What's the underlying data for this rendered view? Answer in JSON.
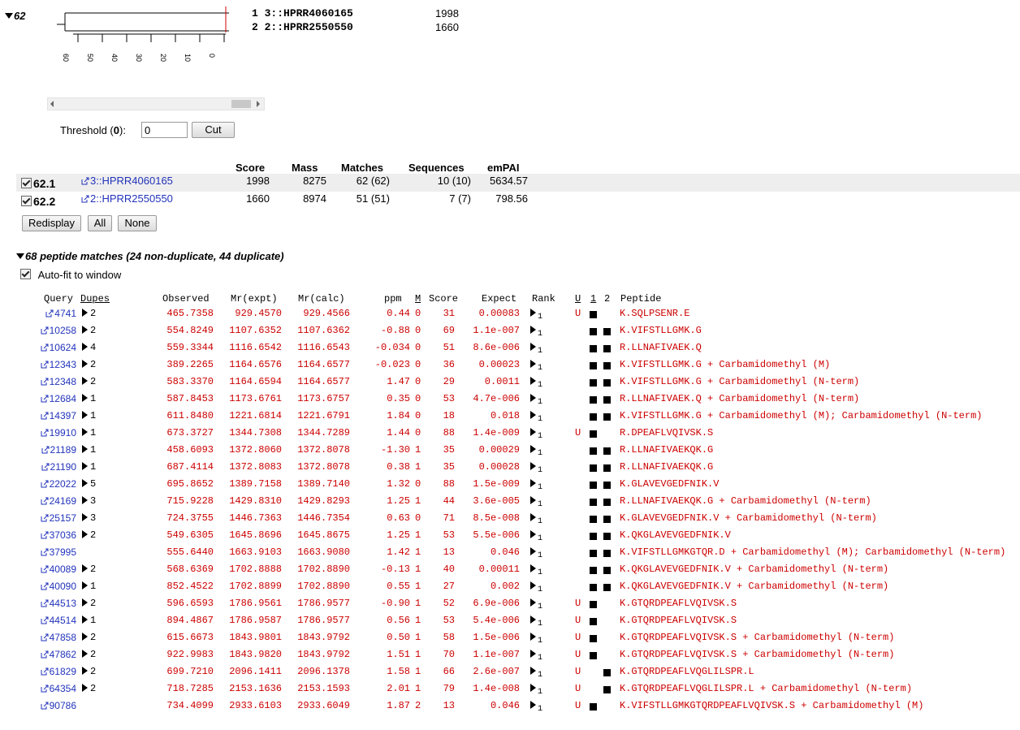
{
  "tree": {
    "node_label": "62",
    "axis_ticks": [
      "60",
      "50",
      "40",
      "30",
      "20",
      "10",
      "0"
    ],
    "hits": [
      {
        "num": "1",
        "name": "3::HPRR4060165",
        "score": "1998"
      },
      {
        "num": "2",
        "name": "2::HPRR2550550",
        "score": "1660"
      }
    ]
  },
  "threshold": {
    "label_pre": "Threshold (",
    "label_bold": "0",
    "label_post": "):",
    "value": "0",
    "cut_label": "Cut"
  },
  "proteins": {
    "headers": {
      "score": "Score",
      "mass": "Mass",
      "matches": "Matches",
      "sequences": "Sequences",
      "empai": "emPAI"
    },
    "rows": [
      {
        "id": "62.1",
        "name": "3::HPRR4060165",
        "score": "1998",
        "mass": "8275",
        "matches": "62 (62)",
        "sequences": "10 (10)",
        "empai": "5634.57"
      },
      {
        "id": "62.2",
        "name": "2::HPRR2550550",
        "score": "1660",
        "mass": "8974",
        "matches": "51 (51)",
        "sequences": "7 (7)",
        "empai": "798.56"
      }
    ],
    "buttons": {
      "redisplay": "Redisplay",
      "all": "All",
      "none": "None"
    }
  },
  "peptides": {
    "section_title": "68 peptide matches (24 non-duplicate, 44 duplicate)",
    "autofit_label": "Auto-fit to window",
    "headers": {
      "query": "Query",
      "dupes": "Dupes",
      "observed": "Observed",
      "mr_expt": "Mr(expt)",
      "mr_calc": "Mr(calc)",
      "ppm": "ppm",
      "m": "M",
      "score": "Score",
      "expect": "Expect",
      "rank": "Rank",
      "u": "U",
      "p1": "1",
      "p2": "2",
      "peptide": "Peptide"
    },
    "rows": [
      {
        "query": "4741",
        "dupes": "2",
        "observed": "465.7358",
        "mr_expt": "929.4570",
        "mr_calc": "929.4566",
        "ppm": "0.44",
        "m": "0",
        "score": "31",
        "expect": "0.00083",
        "rank": "1",
        "u": "U",
        "p1": true,
        "p2": false,
        "peptide": "K.SQLPSENR.E"
      },
      {
        "query": "10258",
        "dupes": "2",
        "observed": "554.8249",
        "mr_expt": "1107.6352",
        "mr_calc": "1107.6362",
        "ppm": "-0.88",
        "m": "0",
        "score": "69",
        "expect": "1.1e-007",
        "rank": "1",
        "u": "",
        "p1": true,
        "p2": true,
        "peptide": "K.VIFSTLLGMK.G"
      },
      {
        "query": "10624",
        "dupes": "4",
        "observed": "559.3344",
        "mr_expt": "1116.6542",
        "mr_calc": "1116.6543",
        "ppm": "-0.034",
        "m": "0",
        "score": "51",
        "expect": "8.6e-006",
        "rank": "1",
        "u": "",
        "p1": true,
        "p2": true,
        "peptide": "R.LLNAFIVAEK.Q"
      },
      {
        "query": "12343",
        "dupes": "2",
        "observed": "389.2265",
        "mr_expt": "1164.6576",
        "mr_calc": "1164.6577",
        "ppm": "-0.023",
        "m": "0",
        "score": "36",
        "expect": "0.00023",
        "rank": "1",
        "u": "",
        "p1": true,
        "p2": true,
        "peptide": "K.VIFSTLLGMK.G + Carbamidomethyl (M)"
      },
      {
        "query": "12348",
        "dupes": "2",
        "observed": "583.3370",
        "mr_expt": "1164.6594",
        "mr_calc": "1164.6577",
        "ppm": "1.47",
        "m": "0",
        "score": "29",
        "expect": "0.0011",
        "rank": "1",
        "u": "",
        "p1": true,
        "p2": true,
        "peptide": "K.VIFSTLLGMK.G + Carbamidomethyl (N-term)"
      },
      {
        "query": "12684",
        "dupes": "1",
        "observed": "587.8453",
        "mr_expt": "1173.6761",
        "mr_calc": "1173.6757",
        "ppm": "0.35",
        "m": "0",
        "score": "53",
        "expect": "4.7e-006",
        "rank": "1",
        "u": "",
        "p1": true,
        "p2": true,
        "peptide": "R.LLNAFIVAEK.Q + Carbamidomethyl (N-term)"
      },
      {
        "query": "14397",
        "dupes": "1",
        "observed": "611.8480",
        "mr_expt": "1221.6814",
        "mr_calc": "1221.6791",
        "ppm": "1.84",
        "m": "0",
        "score": "18",
        "expect": "0.018",
        "rank": "1",
        "u": "",
        "p1": true,
        "p2": true,
        "peptide": "K.VIFSTLLGMK.G + Carbamidomethyl (M); Carbamidomethyl (N-term)"
      },
      {
        "query": "19910",
        "dupes": "1",
        "observed": "673.3727",
        "mr_expt": "1344.7308",
        "mr_calc": "1344.7289",
        "ppm": "1.44",
        "m": "0",
        "score": "88",
        "expect": "1.4e-009",
        "rank": "1",
        "u": "U",
        "p1": true,
        "p2": false,
        "peptide": "R.DPEAFLVQIVSK.S"
      },
      {
        "query": "21189",
        "dupes": "1",
        "observed": "458.6093",
        "mr_expt": "1372.8060",
        "mr_calc": "1372.8078",
        "ppm": "-1.30",
        "m": "1",
        "score": "35",
        "expect": "0.00029",
        "rank": "1",
        "u": "",
        "p1": true,
        "p2": true,
        "peptide": "R.LLNAFIVAEKQK.G"
      },
      {
        "query": "21190",
        "dupes": "1",
        "observed": "687.4114",
        "mr_expt": "1372.8083",
        "mr_calc": "1372.8078",
        "ppm": "0.38",
        "m": "1",
        "score": "35",
        "expect": "0.00028",
        "rank": "1",
        "u": "",
        "p1": true,
        "p2": true,
        "peptide": "R.LLNAFIVAEKQK.G"
      },
      {
        "query": "22022",
        "dupes": "5",
        "observed": "695.8652",
        "mr_expt": "1389.7158",
        "mr_calc": "1389.7140",
        "ppm": "1.32",
        "m": "0",
        "score": "88",
        "expect": "1.5e-009",
        "rank": "1",
        "u": "",
        "p1": true,
        "p2": true,
        "peptide": "K.GLAVEVGEDFNIK.V"
      },
      {
        "query": "24169",
        "dupes": "3",
        "observed": "715.9228",
        "mr_expt": "1429.8310",
        "mr_calc": "1429.8293",
        "ppm": "1.25",
        "m": "1",
        "score": "44",
        "expect": "3.6e-005",
        "rank": "1",
        "u": "",
        "p1": true,
        "p2": true,
        "peptide": "R.LLNAFIVAEKQK.G + Carbamidomethyl (N-term)"
      },
      {
        "query": "25157",
        "dupes": "3",
        "observed": "724.3755",
        "mr_expt": "1446.7363",
        "mr_calc": "1446.7354",
        "ppm": "0.63",
        "m": "0",
        "score": "71",
        "expect": "8.5e-008",
        "rank": "1",
        "u": "",
        "p1": true,
        "p2": true,
        "peptide": "K.GLAVEVGEDFNIK.V + Carbamidomethyl (N-term)"
      },
      {
        "query": "37036",
        "dupes": "2",
        "observed": "549.6305",
        "mr_expt": "1645.8696",
        "mr_calc": "1645.8675",
        "ppm": "1.25",
        "m": "1",
        "score": "53",
        "expect": "5.5e-006",
        "rank": "1",
        "u": "",
        "p1": true,
        "p2": true,
        "peptide": "K.QKGLAVEVGEDFNIK.V"
      },
      {
        "query": "37995",
        "dupes": "",
        "observed": "555.6440",
        "mr_expt": "1663.9103",
        "mr_calc": "1663.9080",
        "ppm": "1.42",
        "m": "1",
        "score": "13",
        "expect": "0.046",
        "rank": "1",
        "u": "",
        "p1": true,
        "p2": true,
        "peptide": "K.VIFSTLLGMKGTQR.D + Carbamidomethyl (M); Carbamidomethyl (N-term)"
      },
      {
        "query": "40089",
        "dupes": "2",
        "observed": "568.6369",
        "mr_expt": "1702.8888",
        "mr_calc": "1702.8890",
        "ppm": "-0.13",
        "m": "1",
        "score": "40",
        "expect": "0.00011",
        "rank": "1",
        "u": "",
        "p1": true,
        "p2": true,
        "peptide": "K.QKGLAVEVGEDFNIK.V + Carbamidomethyl (N-term)"
      },
      {
        "query": "40090",
        "dupes": "1",
        "observed": "852.4522",
        "mr_expt": "1702.8899",
        "mr_calc": "1702.8890",
        "ppm": "0.55",
        "m": "1",
        "score": "27",
        "expect": "0.002",
        "rank": "1",
        "u": "",
        "p1": true,
        "p2": true,
        "peptide": "K.QKGLAVEVGEDFNIK.V + Carbamidomethyl (N-term)"
      },
      {
        "query": "44513",
        "dupes": "2",
        "observed": "596.6593",
        "mr_expt": "1786.9561",
        "mr_calc": "1786.9577",
        "ppm": "-0.90",
        "m": "1",
        "score": "52",
        "expect": "6.9e-006",
        "rank": "1",
        "u": "U",
        "p1": true,
        "p2": false,
        "peptide": "K.GTQRDPEAFLVQIVSK.S"
      },
      {
        "query": "44514",
        "dupes": "1",
        "observed": "894.4867",
        "mr_expt": "1786.9587",
        "mr_calc": "1786.9577",
        "ppm": "0.56",
        "m": "1",
        "score": "53",
        "expect": "5.4e-006",
        "rank": "1",
        "u": "U",
        "p1": true,
        "p2": false,
        "peptide": "K.GTQRDPEAFLVQIVSK.S"
      },
      {
        "query": "47858",
        "dupes": "2",
        "observed": "615.6673",
        "mr_expt": "1843.9801",
        "mr_calc": "1843.9792",
        "ppm": "0.50",
        "m": "1",
        "score": "58",
        "expect": "1.5e-006",
        "rank": "1",
        "u": "U",
        "p1": true,
        "p2": false,
        "peptide": "K.GTQRDPEAFLVQIVSK.S + Carbamidomethyl (N-term)"
      },
      {
        "query": "47862",
        "dupes": "2",
        "observed": "922.9983",
        "mr_expt": "1843.9820",
        "mr_calc": "1843.9792",
        "ppm": "1.51",
        "m": "1",
        "score": "70",
        "expect": "1.1e-007",
        "rank": "1",
        "u": "U",
        "p1": true,
        "p2": false,
        "peptide": "K.GTQRDPEAFLVQIVSK.S + Carbamidomethyl (N-term)"
      },
      {
        "query": "61829",
        "dupes": "2",
        "observed": "699.7210",
        "mr_expt": "2096.1411",
        "mr_calc": "2096.1378",
        "ppm": "1.58",
        "m": "1",
        "score": "66",
        "expect": "2.6e-007",
        "rank": "1",
        "u": "U",
        "p1": false,
        "p2": true,
        "peptide": "K.GTQRDPEAFLVQGLILSPR.L"
      },
      {
        "query": "64354",
        "dupes": "2",
        "observed": "718.7285",
        "mr_expt": "2153.1636",
        "mr_calc": "2153.1593",
        "ppm": "2.01",
        "m": "1",
        "score": "79",
        "expect": "1.4e-008",
        "rank": "1",
        "u": "U",
        "p1": false,
        "p2": true,
        "peptide": "K.GTQRDPEAFLVQGLILSPR.L + Carbamidomethyl (N-term)"
      },
      {
        "query": "90786",
        "dupes": "",
        "observed": "734.4099",
        "mr_expt": "2933.6103",
        "mr_calc": "2933.6049",
        "ppm": "1.87",
        "m": "2",
        "score": "13",
        "expect": "0.046",
        "rank": "1",
        "u": "U",
        "p1": true,
        "p2": false,
        "peptide": "K.VIFSTLLGMKGTQRDPEAFLVQIVSK.S + Carbamidomethyl (M)"
      }
    ]
  },
  "colors": {
    "link": "#2233bb",
    "peptide_text": "#cc0000",
    "row_shade": "#eeeeee"
  }
}
